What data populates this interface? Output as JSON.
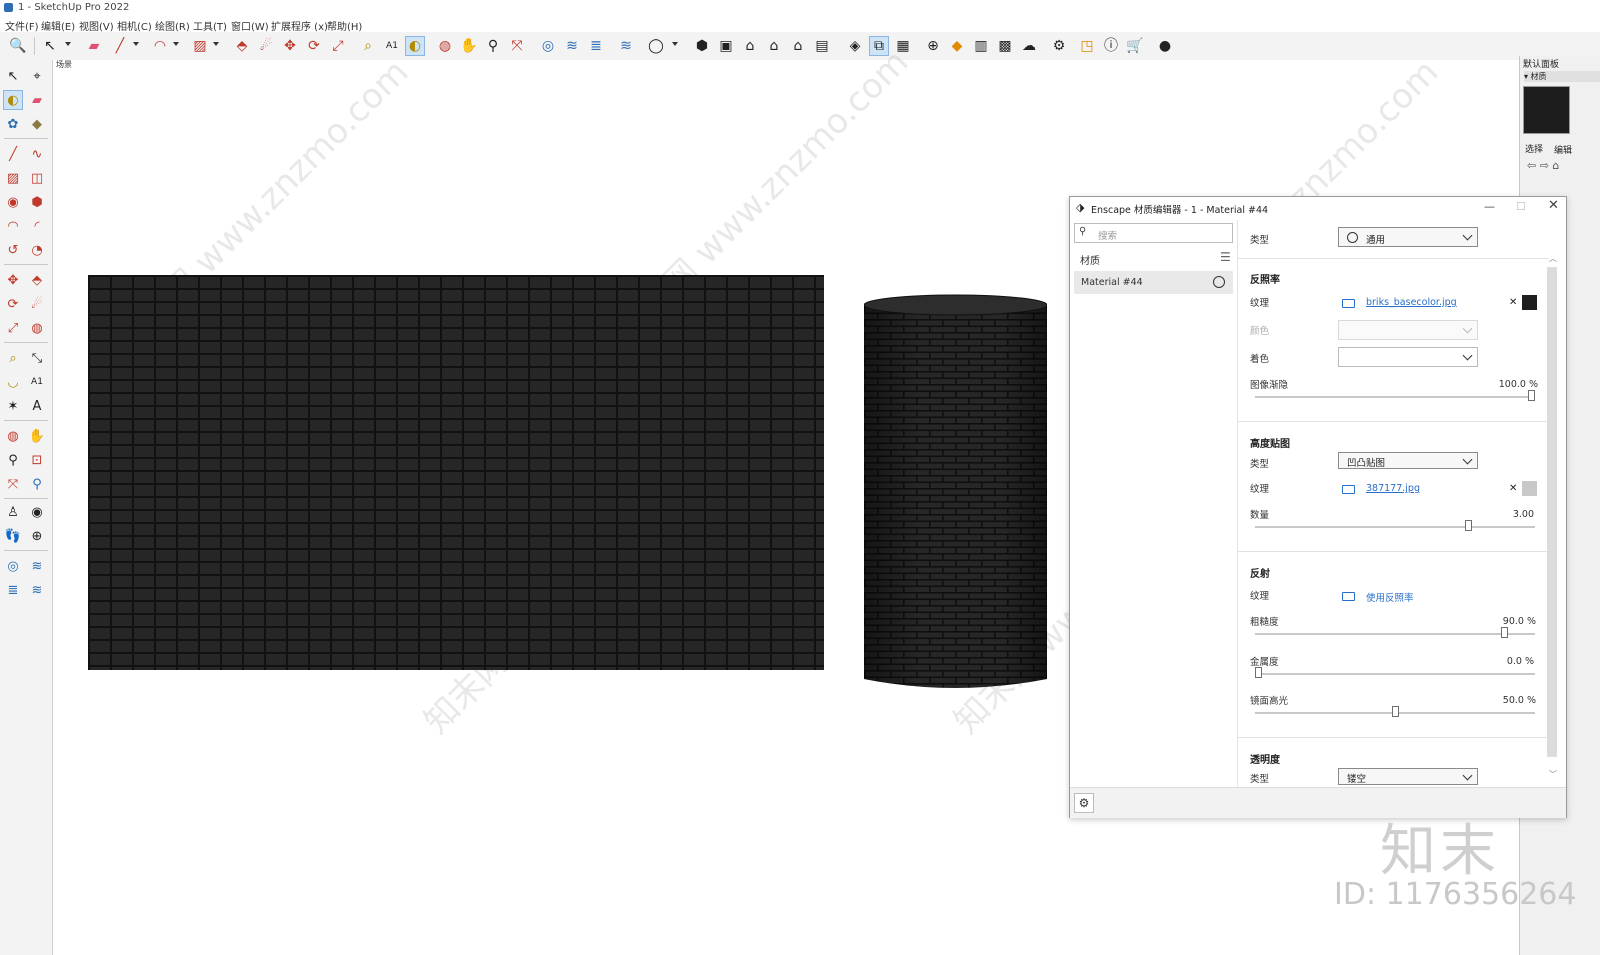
{
  "window": {
    "title": "1 - SketchUp Pro 2022"
  },
  "menu": [
    "文件(F)",
    "编辑(E)",
    "视图(V)",
    "相机(C)",
    "绘图(R)",
    "工具(T)",
    "窗口(W)",
    "扩展程序 (x)",
    "帮助(H)"
  ],
  "viewport": {
    "scene_label": "场景"
  },
  "right_panel": {
    "title": "默认面板",
    "section": "▾ 材质",
    "select_tab": "选择",
    "edit_tab": "编辑",
    "nav": "⇦ ⇨ ⌂"
  },
  "dialog": {
    "icon": "enscape-icon",
    "title": "Enscape 材质编辑器 - 1 - Material #44",
    "search_placeholder": "搜索",
    "materials_header": "材质",
    "material_item": "Material #44",
    "type_label": "类型",
    "type_value": "通用",
    "albedo": {
      "header": "反照率",
      "texture_label": "纹理",
      "texture_file": "briks_basecolor.jpg",
      "texture_swatch_color": "#1e1e1e",
      "color_label": "颜色",
      "tint_label": "着色",
      "fade_label": "图像渐隐",
      "fade_value": "100.0 %",
      "fade_level": 1.0
    },
    "height": {
      "header": "高度贴图",
      "type_label": "类型",
      "type_value": "凹凸贴图",
      "texture_label": "纹理",
      "texture_file": "387177.jpg",
      "texture_swatch_color": "#c8c8c8",
      "amount_label": "数量",
      "amount_value": "3.00",
      "amount_level": 0.77
    },
    "reflection": {
      "header": "反射",
      "texture_label": "纹理",
      "texture_link": "使用反照率",
      "roughness_label": "粗糙度",
      "roughness_value": "90.0 %",
      "roughness_level": 0.9,
      "metallic_label": "金属度",
      "metallic_value": "0.0 %",
      "metallic_level": 0.0,
      "specular_label": "镜面高光",
      "specular_value": "50.0 %",
      "specular_level": 0.5
    },
    "transparency": {
      "header": "透明度",
      "type_label": "类型",
      "type_value": "镂空"
    }
  },
  "watermark": {
    "brand": "知末",
    "id": "ID: 1176356264",
    "diagonal": "知末网 www.znzmo.com"
  }
}
